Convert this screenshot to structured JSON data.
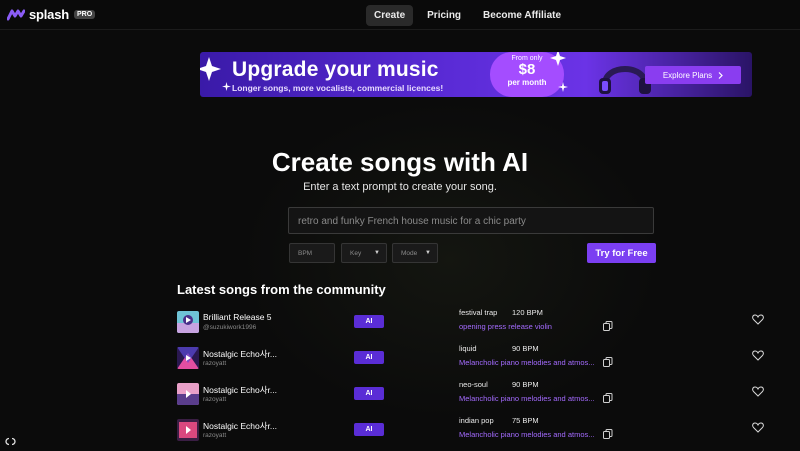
{
  "header": {
    "logo_text": "splash",
    "pro_badge": "PRO",
    "nav": [
      {
        "label": "Create",
        "active": true
      },
      {
        "label": "Pricing",
        "active": false
      },
      {
        "label": "Become Affiliate",
        "active": false
      }
    ]
  },
  "banner": {
    "title": "Upgrade your music",
    "subtitle": "Longer songs, more vocalists, commercial licences!",
    "price_from": "From only",
    "price_amount": "$8",
    "price_period": "per month",
    "cta": "Explore Plans"
  },
  "hero": {
    "title": "Create songs with AI",
    "subtitle": "Enter a text prompt to create your song.",
    "prompt_placeholder": "retro and funky French house music for a chic party",
    "bpm_placeholder": "BPM",
    "key_label": "Key",
    "mode_label": "Mode",
    "try_button": "Try for Free"
  },
  "community": {
    "title": "Latest songs from the community",
    "songs": [
      {
        "title": "Brilliant Release 5",
        "user": "@suzukiwork1996",
        "badge": "AI",
        "genre": "festival trap",
        "bpm": "120 BPM",
        "description": "opening press release violin"
      },
      {
        "title": "Nostalgic Echo사r...",
        "user": "razoyatt",
        "badge": "AI",
        "genre": "liquid",
        "bpm": "90 BPM",
        "description": "Melancholic piano melodies and atmos..."
      },
      {
        "title": "Nostalgic Echo사r...",
        "user": "razoyatt",
        "badge": "AI",
        "genre": "neo-soul",
        "bpm": "90 BPM",
        "description": "Melancholic piano melodies and atmos..."
      },
      {
        "title": "Nostalgic Echo사r...",
        "user": "razoyatt",
        "badge": "AI",
        "genre": "indian pop",
        "bpm": "75 BPM",
        "description": "Melancholic piano melodies and atmos..."
      }
    ]
  },
  "colors": {
    "accent": "#7b3ff2",
    "description_text": "#a46bff",
    "background": "#0b0b0b"
  }
}
